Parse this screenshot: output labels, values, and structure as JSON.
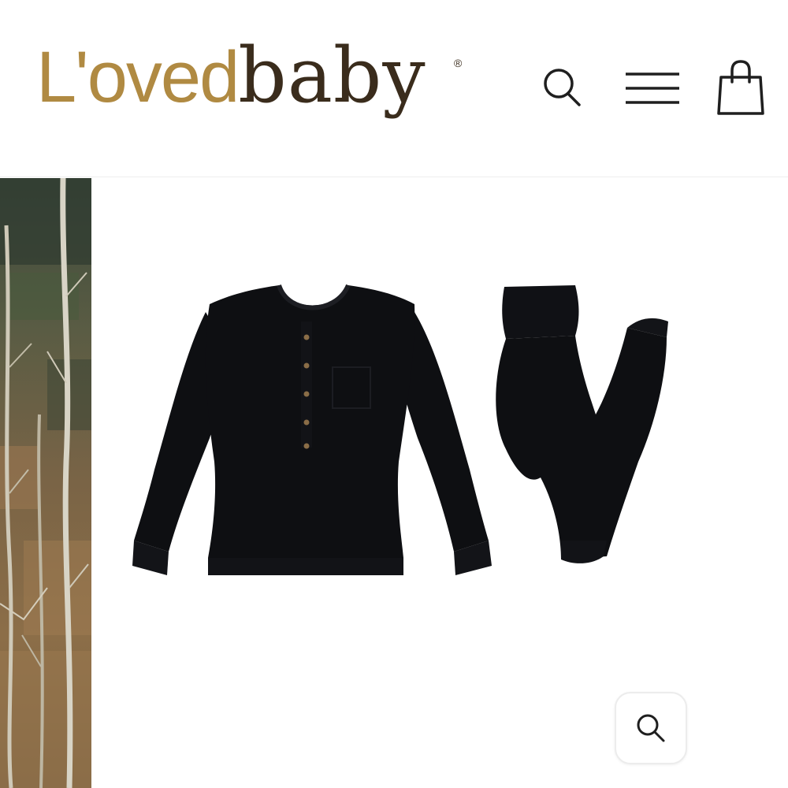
{
  "header": {
    "logo": {
      "part1": "L'oved",
      "part2": "baby",
      "registered": "®",
      "color_gold": "#b08a42",
      "color_brown": "#3a2c1c"
    },
    "icons": {
      "search": "search-icon",
      "menu": "hamburger-menu-icon",
      "cart": "shopping-bag-icon"
    }
  },
  "gallery": {
    "side_image": "forest-aspen-trees-photo",
    "main_image": "black-henley-pajama-set-photo",
    "zoom_button_icon": "zoom-search-icon"
  },
  "colors": {
    "icon_stroke": "#1f1f1f",
    "garment": "#0e0f12",
    "button_accent": "#8a6d47"
  }
}
